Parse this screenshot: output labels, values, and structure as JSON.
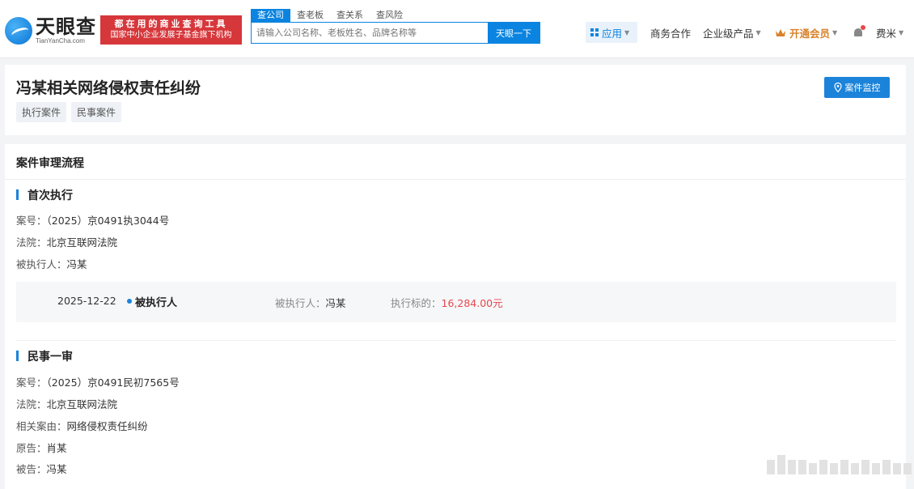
{
  "header": {
    "logo_cn": "天眼查",
    "logo_en": "TianYanCha.com",
    "slogan_line1": "都在用的商业查询工具",
    "slogan_line2": "国家中小企业发展子基金旗下机构",
    "search_tabs": [
      "查公司",
      "查老板",
      "查关系",
      "查风险"
    ],
    "search_placeholder": "请输入公司名称、老板姓名、品牌名称等",
    "search_button": "天眼一下",
    "nav_app": "应用",
    "nav_business": "商务合作",
    "nav_products": "企业级产品",
    "nav_vip": "开通会员",
    "nav_user": "费米"
  },
  "case": {
    "title": "冯某相关网络侵权责任纠纷",
    "tags": [
      "执行案件",
      "民事案件"
    ],
    "monitor_button": "案件监控"
  },
  "process": {
    "heading": "案件审理流程",
    "stage1": {
      "title": "首次执行",
      "case_no_label": "案号：",
      "case_no": "（2025）京0491执3044号",
      "court_label": "法院：",
      "court": "北京互联网法院",
      "party_label": "被执行人：",
      "party": "冯某",
      "timeline": {
        "date": "2025-12-22",
        "role": "被执行人",
        "party_label": "被执行人：",
        "party": "冯某",
        "amount_label": "执行标的：",
        "amount": "16,284.00元"
      }
    },
    "stage2": {
      "title": "民事一审",
      "case_no_label": "案号：",
      "case_no": "（2025）京0491民初7565号",
      "court_label": "法院：",
      "court": "北京互联网法院",
      "cause_label": "相关案由：",
      "cause": "网络侵权责任纠纷",
      "plaintiff_label": "原告：",
      "plaintiff": "肖某",
      "defendant_label": "被告：",
      "defendant": "冯某"
    }
  },
  "colors": {
    "brand_blue": "#0a84e0",
    "slogan_red": "#d6373b",
    "amount_red": "#e5484d",
    "vip_orange": "#d9822b"
  }
}
